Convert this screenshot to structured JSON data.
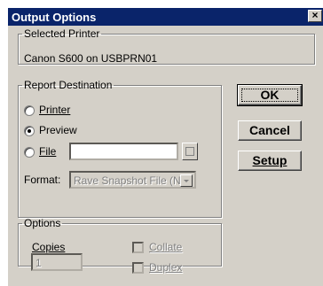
{
  "window": {
    "title": "Output Options",
    "close_glyph": "×"
  },
  "selected_printer": {
    "legend": "Selected Printer",
    "value": "Canon S600 on USBPRN01"
  },
  "report_destination": {
    "legend": "Report Destination",
    "printer_label": "Printer",
    "preview_label": "Preview",
    "file_label": "File",
    "selected": "Preview",
    "file_value": "",
    "format_label": "Format:",
    "format_value": "Rave Snapshot File (ND"
  },
  "options": {
    "legend": "Options",
    "copies_label": "Copies",
    "copies_value": "1",
    "collate_label": "Collate",
    "duplex_label": "Duplex"
  },
  "buttons": {
    "ok": "OK",
    "cancel": "Cancel",
    "setup": "Setup"
  },
  "colors": {
    "titlebar": "#0a246a",
    "face": "#d4d0c8",
    "disabled_text": "#808080"
  }
}
